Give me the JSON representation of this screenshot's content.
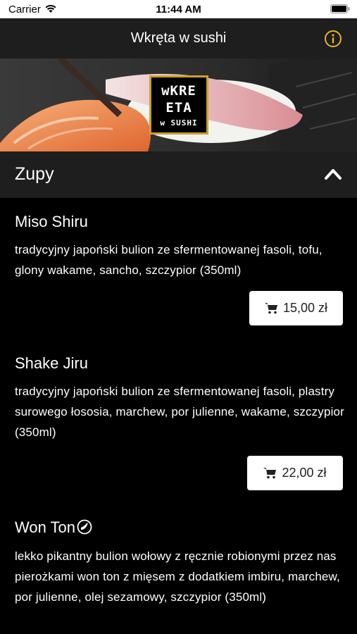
{
  "status_bar": {
    "carrier": "Carrier",
    "time": "11:44 AM"
  },
  "nav": {
    "title": "Wkręta w sushi",
    "info_icon": "info-icon"
  },
  "banner": {
    "logo_line1": "wKRE",
    "logo_line2": "ETA",
    "logo_line3": "w SUSHI"
  },
  "section": {
    "title": "Zupy",
    "expanded": true
  },
  "items": [
    {
      "name": "Miso Shiru",
      "description": "tradycyjny japoński bulion ze sfermentowanej fasoli, tofu, glony wakame, sancho, szczypior (350ml)",
      "price": "15,00 zł"
    },
    {
      "name": "Shake Jiru",
      "description": "tradycyjny japoński bulion ze sfermentowanej fasoli, plastry surowego łososia, marchew, por julienne, wakame, szczypior (350ml)",
      "price": "22,00 zł"
    },
    {
      "name": "Won Ton",
      "spicy": true,
      "description": "lekko pikantny bulion wołowy z ręcznie robionymi przez nas pierożkami won ton z mięsem z dodatkiem imbiru, marchew, por julienne, olej sezamowy, szczypior (350ml)",
      "price": ""
    }
  ],
  "colors": {
    "accent": "#e8b32a",
    "background": "#000000",
    "header": "#1e1e1e"
  }
}
